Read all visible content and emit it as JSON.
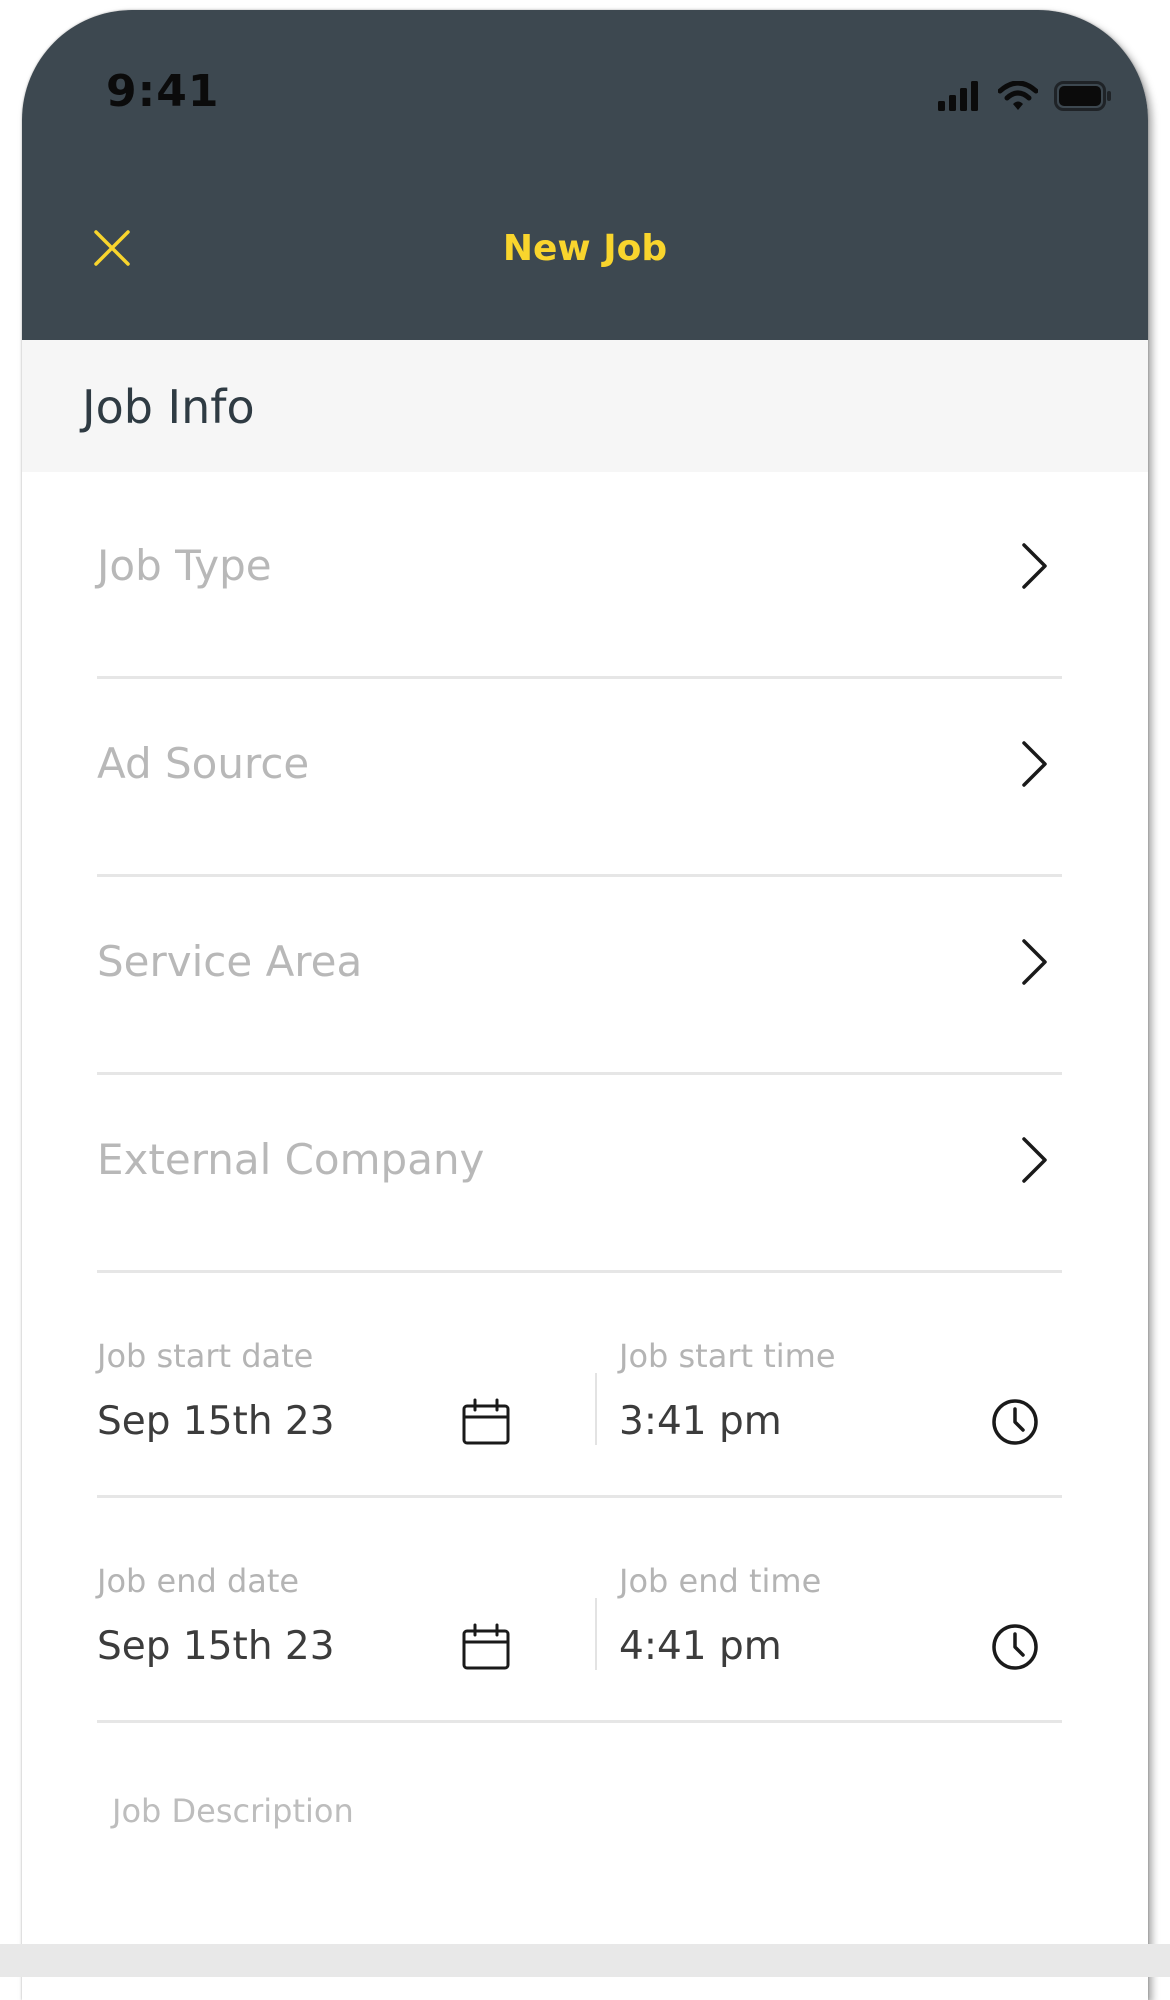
{
  "status_bar": {
    "time": "9:41",
    "icons": [
      "signal-icon",
      "wifi-icon",
      "battery-icon"
    ]
  },
  "nav": {
    "title": "New Job",
    "close_icon": "close-icon"
  },
  "section": {
    "title": "Job Info"
  },
  "fields": [
    {
      "placeholder": "Job Type"
    },
    {
      "placeholder": "Ad Source"
    },
    {
      "placeholder": "Service Area"
    },
    {
      "placeholder": "External Company"
    }
  ],
  "schedule": {
    "start": {
      "date_label": "Job start date",
      "date_value": "Sep 15th 23",
      "time_label": "Job start time",
      "time_value": "3:41 pm"
    },
    "end": {
      "date_label": "Job end date",
      "date_value": "Sep 15th 23",
      "time_label": "Job end time",
      "time_value": "4:41 pm"
    }
  },
  "description": {
    "placeholder": "Job Description"
  },
  "colors": {
    "header_bg": "#3d4850",
    "accent": "#f9d52d",
    "section_bg": "#f6f6f6",
    "placeholder_text": "#b8b8b8",
    "value_text": "#3c3c3c",
    "divider": "#e6e6e6"
  }
}
